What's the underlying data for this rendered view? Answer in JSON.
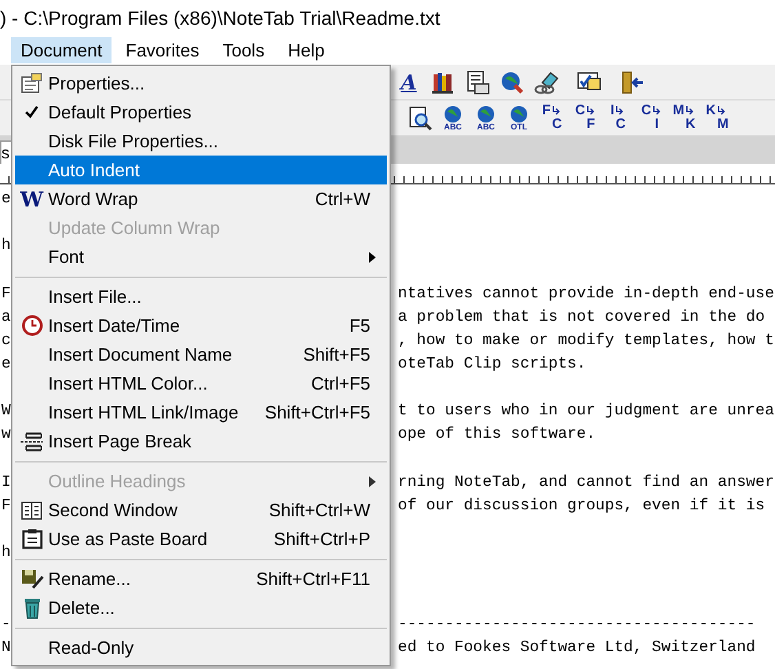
{
  "window": {
    "title": ")  -  C:\\Program Files (x86)\\NoteTab Trial\\Readme.txt"
  },
  "menu_bar": [
    {
      "label": "Document",
      "selected": true
    },
    {
      "label": "Favorites",
      "selected": false
    },
    {
      "label": "Tools",
      "selected": false
    },
    {
      "label": "Help",
      "selected": false
    }
  ],
  "toolbar_1": [
    {
      "kind": "font",
      "glyph": "A"
    },
    {
      "kind": "books"
    },
    {
      "kind": "document"
    },
    {
      "kind": "globe-search"
    },
    {
      "kind": "eraser"
    },
    {
      "kind": "check"
    },
    {
      "kind": "exit"
    }
  ],
  "toolbar_2": [
    {
      "kind": "doc-search"
    },
    {
      "kind": "globe",
      "caption": "ABC"
    },
    {
      "kind": "globe",
      "caption": "ABC"
    },
    {
      "kind": "globe",
      "caption": "OTL"
    },
    {
      "kind": "convert",
      "from": "F",
      "to": "C"
    },
    {
      "kind": "convert",
      "from": "C",
      "to": "F"
    },
    {
      "kind": "convert",
      "from": "I",
      "to": "C"
    },
    {
      "kind": "convert",
      "from": "C",
      "to": "I"
    },
    {
      "kind": "convert",
      "from": "M",
      "to": "K"
    },
    {
      "kind": "convert",
      "from": "K",
      "to": "M"
    }
  ],
  "tabs": [
    {
      "label": "s",
      "selected": true
    }
  ],
  "editor_lines": [
    {
      "kind": "text",
      "left": "e"
    },
    {
      "kind": "blank"
    },
    {
      "kind": "text",
      "left": "h"
    },
    {
      "kind": "blank"
    },
    {
      "left": "F",
      "right": "ntatives cannot provide in-depth end-use"
    },
    {
      "left": "a",
      "right": "a problem that is not covered in the do"
    },
    {
      "left": "c",
      "right": ", how to make or modify templates, how t"
    },
    {
      "left": "e",
      "right": "oteTab Clip scripts."
    },
    {
      "kind": "blank"
    },
    {
      "left": "W",
      "right": "t to users who in our judgment are unrea"
    },
    {
      "left": "w",
      "right": "ope of this software."
    },
    {
      "kind": "blank"
    },
    {
      "left": "I",
      "right": "rning NoteTab, and cannot find an answer"
    },
    {
      "left": "F",
      "right": "of our discussion groups, even if it is"
    },
    {
      "kind": "blank"
    },
    {
      "kind": "text",
      "left": "h"
    },
    {
      "kind": "blank"
    },
    {
      "kind": "blank"
    },
    {
      "left": "-",
      "right": "--------------------------------------"
    },
    {
      "left": "N",
      "right": "ed to Fookes Software Ltd, Switzerland"
    }
  ],
  "menu": [
    {
      "kind": "item",
      "label": "Properties...",
      "checked": false,
      "disabled": false,
      "selected": false,
      "submenu": false
    },
    {
      "kind": "item",
      "label": "Default Properties",
      "checked": true,
      "disabled": false,
      "selected": false,
      "submenu": false
    },
    {
      "kind": "item",
      "label": "Disk File Properties...",
      "checked": false,
      "disabled": false,
      "selected": false,
      "submenu": false
    },
    {
      "kind": "item",
      "label": "Auto Indent",
      "checked": false,
      "disabled": false,
      "selected": true,
      "submenu": false
    },
    {
      "kind": "item",
      "label": "Word Wrap",
      "glyph": "W",
      "shortcut": "Ctrl+W",
      "checked": false,
      "disabled": false,
      "selected": false,
      "submenu": false
    },
    {
      "kind": "item",
      "label": "Update Column Wrap",
      "checked": false,
      "disabled": true,
      "selected": false,
      "submenu": false
    },
    {
      "kind": "item",
      "label": "Font",
      "checked": false,
      "disabled": false,
      "selected": false,
      "submenu": true
    },
    {
      "kind": "separator"
    },
    {
      "kind": "item",
      "label": "Insert File...",
      "checked": false,
      "disabled": false,
      "selected": false,
      "submenu": false
    },
    {
      "kind": "item",
      "label": "Insert Date/Time",
      "shortcut": "F5",
      "checked": false,
      "disabled": false,
      "selected": false,
      "submenu": false
    },
    {
      "kind": "item",
      "label": "Insert Document Name",
      "shortcut": "Shift+F5",
      "checked": false,
      "disabled": false,
      "selected": false,
      "submenu": false
    },
    {
      "kind": "item",
      "label": "Insert HTML Color...",
      "shortcut": "Ctrl+F5",
      "checked": false,
      "disabled": false,
      "selected": false,
      "submenu": false
    },
    {
      "kind": "item",
      "label": "Insert HTML Link/Image",
      "shortcut": "Shift+Ctrl+F5",
      "checked": false,
      "disabled": false,
      "selected": false,
      "submenu": false
    },
    {
      "kind": "item",
      "label": "Insert Page Break",
      "checked": false,
      "disabled": false,
      "selected": false,
      "submenu": false
    },
    {
      "kind": "separator"
    },
    {
      "kind": "item",
      "label": "Outline Headings",
      "checked": false,
      "disabled": true,
      "selected": false,
      "submenu": true
    },
    {
      "kind": "item",
      "label": "Second Window",
      "shortcut": "Shift+Ctrl+W",
      "checked": false,
      "disabled": false,
      "selected": false,
      "submenu": false
    },
    {
      "kind": "item",
      "label": "Use as Paste Board",
      "shortcut": "Shift+Ctrl+P",
      "checked": false,
      "disabled": false,
      "selected": false,
      "submenu": false
    },
    {
      "kind": "separator"
    },
    {
      "kind": "item",
      "label": "Rename...",
      "shortcut": "Shift+Ctrl+F11",
      "checked": false,
      "disabled": false,
      "selected": false,
      "submenu": false
    },
    {
      "kind": "item",
      "label": "Delete...",
      "checked": false,
      "disabled": false,
      "selected": false,
      "submenu": false
    },
    {
      "kind": "separator"
    },
    {
      "kind": "item",
      "label": "Read-Only",
      "checked": false,
      "disabled": false,
      "selected": false,
      "submenu": false
    }
  ]
}
